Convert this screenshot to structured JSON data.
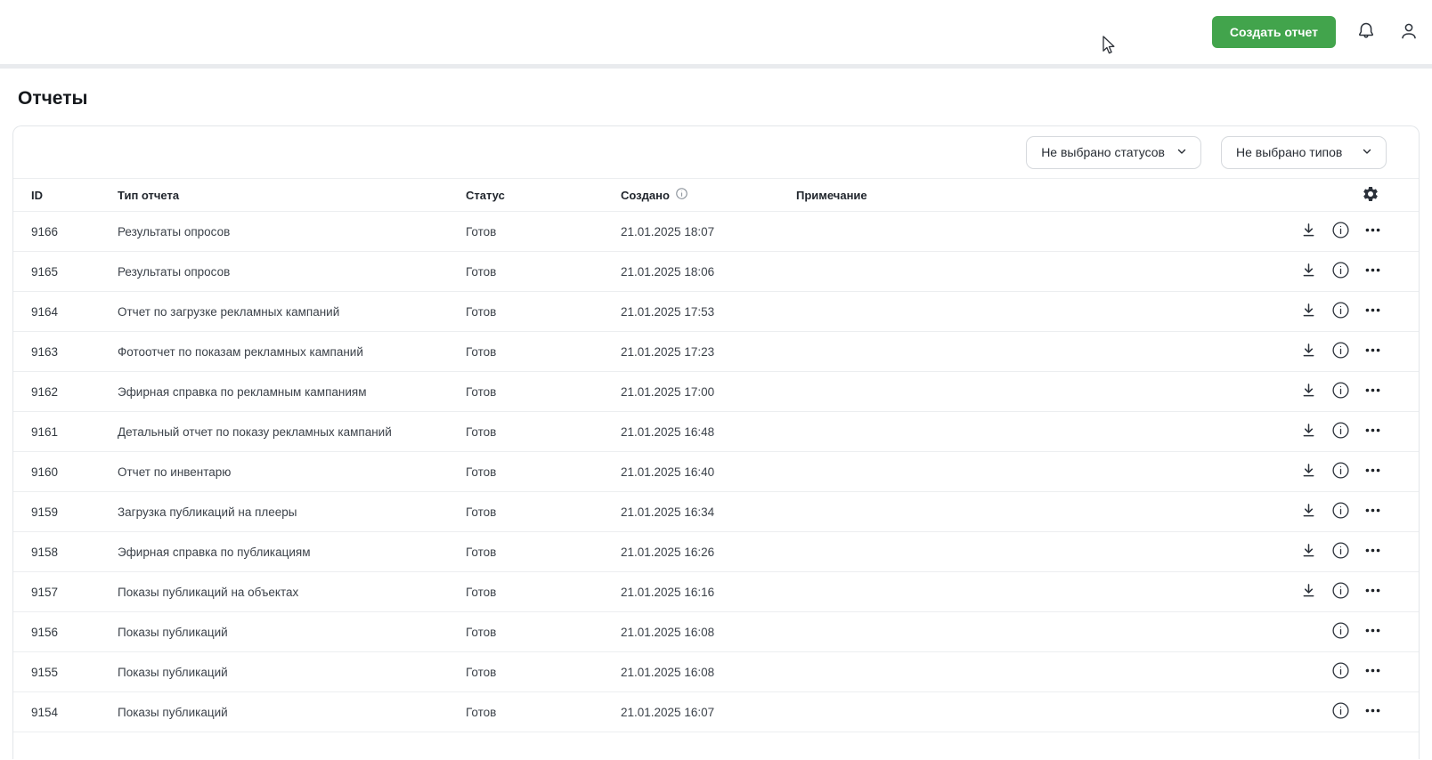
{
  "topbar": {
    "create_report_label": "Создать отчет",
    "icons": [
      "bell-icon",
      "user-icon"
    ]
  },
  "page": {
    "title": "Отчеты"
  },
  "filters": {
    "status_filter_value": "Не выбрано статусов",
    "type_filter_value": "Не выбрано типов"
  },
  "table": {
    "columns": {
      "id": "ID",
      "type": "Тип отчета",
      "status": "Статус",
      "created": "Создано",
      "note": "Примечание"
    },
    "rows": [
      {
        "id": "9166",
        "type": "Результаты опросов",
        "status": "Готов",
        "created": "21.01.2025 18:07",
        "note": "",
        "downloadable": true
      },
      {
        "id": "9165",
        "type": "Результаты опросов",
        "status": "Готов",
        "created": "21.01.2025 18:06",
        "note": "",
        "downloadable": true
      },
      {
        "id": "9164",
        "type": "Отчет по загрузке рекламных кампаний",
        "status": "Готов",
        "created": "21.01.2025 17:53",
        "note": "",
        "downloadable": true
      },
      {
        "id": "9163",
        "type": "Фотоотчет по показам рекламных кампаний",
        "status": "Готов",
        "created": "21.01.2025 17:23",
        "note": "",
        "downloadable": true
      },
      {
        "id": "9162",
        "type": "Эфирная справка по рекламным кампаниям",
        "status": "Готов",
        "created": "21.01.2025 17:00",
        "note": "",
        "downloadable": true
      },
      {
        "id": "9161",
        "type": "Детальный отчет по показу рекламных кампаний",
        "status": "Готов",
        "created": "21.01.2025 16:48",
        "note": "",
        "downloadable": true
      },
      {
        "id": "9160",
        "type": "Отчет по инвентарю",
        "status": "Готов",
        "created": "21.01.2025 16:40",
        "note": "",
        "downloadable": true
      },
      {
        "id": "9159",
        "type": "Загрузка публикаций на плееры",
        "status": "Готов",
        "created": "21.01.2025 16:34",
        "note": "",
        "downloadable": true
      },
      {
        "id": "9158",
        "type": "Эфирная справка по публикациям",
        "status": "Готов",
        "created": "21.01.2025 16:26",
        "note": "",
        "downloadable": true
      },
      {
        "id": "9157",
        "type": "Показы публикаций на объектах",
        "status": "Готов",
        "created": "21.01.2025 16:16",
        "note": "",
        "downloadable": true
      },
      {
        "id": "9156",
        "type": "Показы публикаций",
        "status": "Готов",
        "created": "21.01.2025 16:08",
        "note": "",
        "downloadable": false
      },
      {
        "id": "9155",
        "type": "Показы публикаций",
        "status": "Готов",
        "created": "21.01.2025 16:08",
        "note": "",
        "downloadable": false
      },
      {
        "id": "9154",
        "type": "Показы публикаций",
        "status": "Готов",
        "created": "21.01.2025 16:07",
        "note": "",
        "downloadable": false
      }
    ],
    "row_action_icons": [
      "download-icon",
      "info-icon",
      "ellipsis-icon"
    ],
    "header_icons": [
      "info-icon",
      "gear-icon"
    ]
  },
  "colors": {
    "accent_green": "#42a44c",
    "text_primary": "#21262d",
    "text_secondary": "#3c424a",
    "row_border": "#eceef0",
    "card_border": "#e3e6e9",
    "dropdown_border": "#d6d9dd",
    "muted_icon": "#8f969e",
    "icon_dark": "#2c323b"
  }
}
